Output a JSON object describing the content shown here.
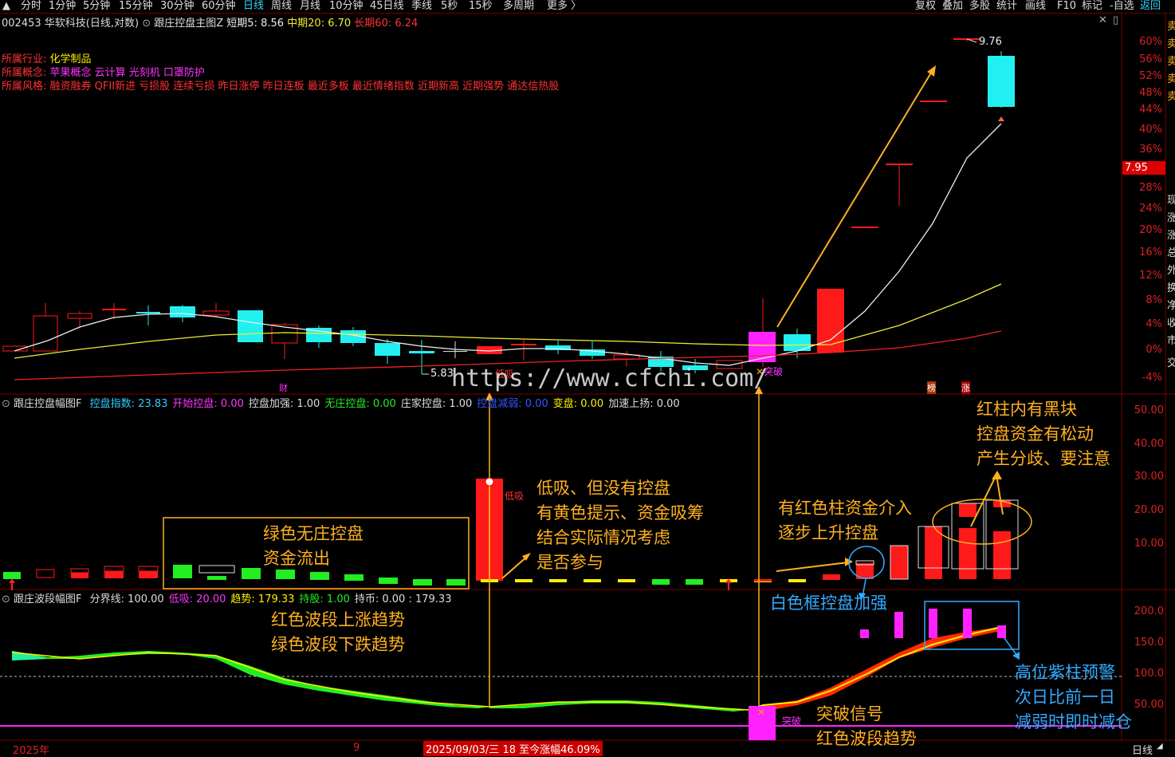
{
  "topbar": {
    "periods": [
      "分时",
      "1分钟",
      "5分钟",
      "15分钟",
      "30分钟",
      "60分钟",
      "日线",
      "周线",
      "月线",
      "10分钟",
      "45日线",
      "季线",
      "5秒",
      "15秒",
      "多周期",
      "更多 〉"
    ],
    "active_period": "日线",
    "right_buttons": [
      "复权",
      "叠加",
      "多股",
      "统计",
      "画线",
      "F10",
      "标记",
      "-自选",
      "返回"
    ]
  },
  "main_header": {
    "stock": "002453 华软科技(日线,对数)",
    "indicator": "跟庄控盘主图Z",
    "short_label": "短期5: 8.56",
    "mid_label": "中期20: 6.70",
    "long_label": "长期60: 6.24"
  },
  "info": {
    "industry_label": "所属行业:",
    "industry": "化学制品",
    "concept_label": "所属概念:",
    "concepts": "苹果概念  云计算  光刻机  口罩防护",
    "style_label": "所属风格:",
    "styles": "融资融券  QFII新进  亏损股  连续亏损  昨日涨停  昨日连板  最近多板  最近情绪指数  近期新高  近期强势  通达信热股"
  },
  "price_axis": [
    "60%",
    "56%",
    "52%",
    "48%",
    "44%",
    "40%",
    "36%",
    "32%",
    "28%",
    "24%",
    "20%",
    "16%",
    "12%",
    "8%",
    "4%",
    "0%",
    "-4%"
  ],
  "current_price": "7.95",
  "main_labels": {
    "high": "9.76",
    "low": "5.83",
    "low_buy": "低吸",
    "breakout": "突破",
    "cai": "财",
    "bang": "榜",
    "zhang": "涨",
    "watermark": "https://www.cfchi.com/"
  },
  "right_edge_chars": [
    "卖",
    "卖",
    "卖",
    "卖",
    "卖",
    "现",
    "涨",
    "涨",
    "总",
    "外",
    "换",
    "净",
    "收",
    "市",
    "交"
  ],
  "panel2_header": {
    "title": "跟庄控盘幅图F",
    "items": [
      {
        "text": "控盘指数: 23.83",
        "color": "#33ccff"
      },
      {
        "text": "开始控盘: 0.00",
        "color": "#ff33ff"
      },
      {
        "text": "控盘加强: 1.00",
        "color": "#dddddd"
      },
      {
        "text": "无庄控盘: 0.00",
        "color": "#22ee22"
      },
      {
        "text": "庄家控盘: 1.00",
        "color": "#dddddd"
      },
      {
        "text": "控盘减弱: 0.00",
        "color": "#3355ff"
      },
      {
        "text": "变盘: 0.00",
        "color": "#ffee00"
      },
      {
        "text": "加速上扬: 0.00",
        "color": "#dddddd"
      }
    ]
  },
  "panel2_axis": [
    "50.00",
    "40.00",
    "30.00",
    "20.00",
    "10.00"
  ],
  "panel3_header": {
    "title": "跟庄波段幅图F",
    "items": [
      {
        "text": "分界线: 100.00",
        "color": "#dddddd"
      },
      {
        "text": "低吸: 20.00",
        "color": "#ff33ff"
      },
      {
        "text": "趋势: 179.33",
        "color": "#ffee00"
      },
      {
        "text": "持股: 1.00",
        "color": "#22ee22"
      },
      {
        "text": "持币: 0.00 : 179.33",
        "color": "#dddddd"
      }
    ]
  },
  "panel3_axis": [
    "200.0",
    "150.0",
    "100.0",
    "50.00"
  ],
  "panel3_labels": {
    "breakout": "突破"
  },
  "bottom": {
    "year": "2025年",
    "month": "9",
    "status": "2025/09/03/三 18 至今涨幅46.09%",
    "period": "日线"
  },
  "annotations": {
    "green_no_control": "绿色无庄控盘\n资金流出",
    "low_buy_note": "低吸、但没有控盘\n有黄色提示、资金吸筹\n结合实际情况考虑\n是否参与",
    "red_bar_inflow": "有红色柱资金介入\n逐步上升控盘",
    "black_block_note": "红柱内有黑块\n控盘资金有松动\n产生分歧、要注意",
    "white_box_note": "白色框控盘加强",
    "wave_trend": "红色波段上涨趋势\n绿色波段下跌趋势",
    "purple_warning": "高位紫柱预警\n次日比前一日\n减弱时即时减仓",
    "breakout_signal": "突破信号\n红色波段趋势"
  },
  "colors": {
    "up": "#ff1a1a",
    "down": "#22f0f0",
    "axis_red": "#d22222",
    "annotation_orange": "#ffb020",
    "annotation_blue": "#33aaff",
    "magenta": "#ff22ff",
    "green": "#22ee22",
    "yellow": "#ffee00"
  }
}
